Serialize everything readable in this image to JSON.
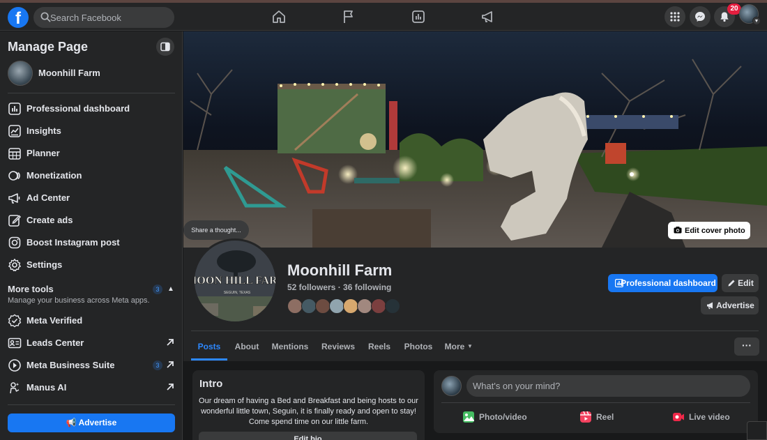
{
  "topbar": {
    "logo_letter": "f",
    "search_placeholder": "Search Facebook",
    "nav_icons": [
      "home-icon",
      "flag-icon",
      "insights-icon",
      "megaphone-icon"
    ],
    "right_icons": [
      "menu-grid-icon",
      "messenger-icon",
      "bell-icon"
    ],
    "notification_count": "20"
  },
  "sidebar": {
    "title": "Manage Page",
    "page_name": "Moonhill Farm",
    "items": [
      {
        "label": "Professional dashboard",
        "icon": "dashboard-icon"
      },
      {
        "label": "Insights",
        "icon": "insights-icon"
      },
      {
        "label": "Planner",
        "icon": "calendar-icon"
      },
      {
        "label": "Monetization",
        "icon": "monetization-icon"
      },
      {
        "label": "Ad Center",
        "icon": "megaphone-icon"
      },
      {
        "label": "Create ads",
        "icon": "pencil-icon"
      },
      {
        "label": "Boost Instagram post",
        "icon": "instagram-icon"
      },
      {
        "label": "Settings",
        "icon": "gear-icon"
      }
    ],
    "more_tools": {
      "title": "More tools",
      "badge": "3",
      "subtitle": "Manage your business across Meta apps."
    },
    "tools": [
      {
        "label": "Meta Verified",
        "icon": "verified-icon"
      },
      {
        "label": "Leads Center",
        "icon": "leads-icon",
        "external": true
      },
      {
        "label": "Meta Business Suite",
        "icon": "business-suite-icon",
        "badge": "3",
        "external": true
      },
      {
        "label": "Manus AI",
        "icon": "ai-icon",
        "external": true
      }
    ],
    "advertise_label": "Advertise"
  },
  "cover": {
    "share_thought": "Share a thought...",
    "edit_cover_label": "Edit cover photo"
  },
  "profile": {
    "name": "Moonhill Farm",
    "stats": "52 followers · 36 following",
    "pic_text_1": "MOON HILL FARM",
    "pic_text_2": "SEGUIN, TEXAS",
    "professional_dashboard_label": "Professional dashboard",
    "edit_label": "Edit",
    "advertise_label": "Advertise"
  },
  "tabs": [
    "Posts",
    "About",
    "Mentions",
    "Reviews",
    "Reels",
    "Photos",
    "More"
  ],
  "tab_more_dots": "···",
  "intro": {
    "title": "Intro",
    "bio": "Our dream of having a Bed and Breakfast and being hosts to our wonderful little town, Seguin, it is finally ready and open to stay! Come spend time on our little farm.",
    "edit_bio_label": "Edit bio"
  },
  "composer": {
    "placeholder": "What's on your mind?",
    "actions": [
      {
        "label": "Photo/video",
        "color": "#45bd62"
      },
      {
        "label": "Reel",
        "color": "#f3425f"
      },
      {
        "label": "Live video",
        "color": "#f02849"
      }
    ]
  },
  "colors": {
    "accent": "#1877f2",
    "active_tab": "#2d88ff",
    "background": "#18191a",
    "surface": "#242526"
  }
}
